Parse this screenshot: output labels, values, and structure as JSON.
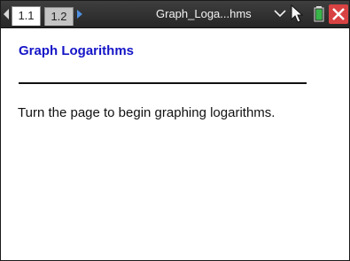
{
  "toolbar": {
    "tabs": [
      {
        "label": "1.1",
        "active": true
      },
      {
        "label": "1.2",
        "active": false
      }
    ],
    "document_title": "Graph_Loga...hms",
    "icons": {
      "prev": "triangle-left-icon",
      "next": "triangle-right-icon",
      "menu": "chevron-down-icon",
      "cursor": "pointer-cursor-icon",
      "battery": "battery-icon",
      "close": "close-icon"
    },
    "colors": {
      "bar": "#303030",
      "next_arrow": "#4f8fe0",
      "battery": "#39b54a",
      "close": "#d84242"
    }
  },
  "page": {
    "heading": "Graph Logarithms",
    "body": "Turn the page to begin graphing logarithms.",
    "heading_color": "#1515c8"
  }
}
